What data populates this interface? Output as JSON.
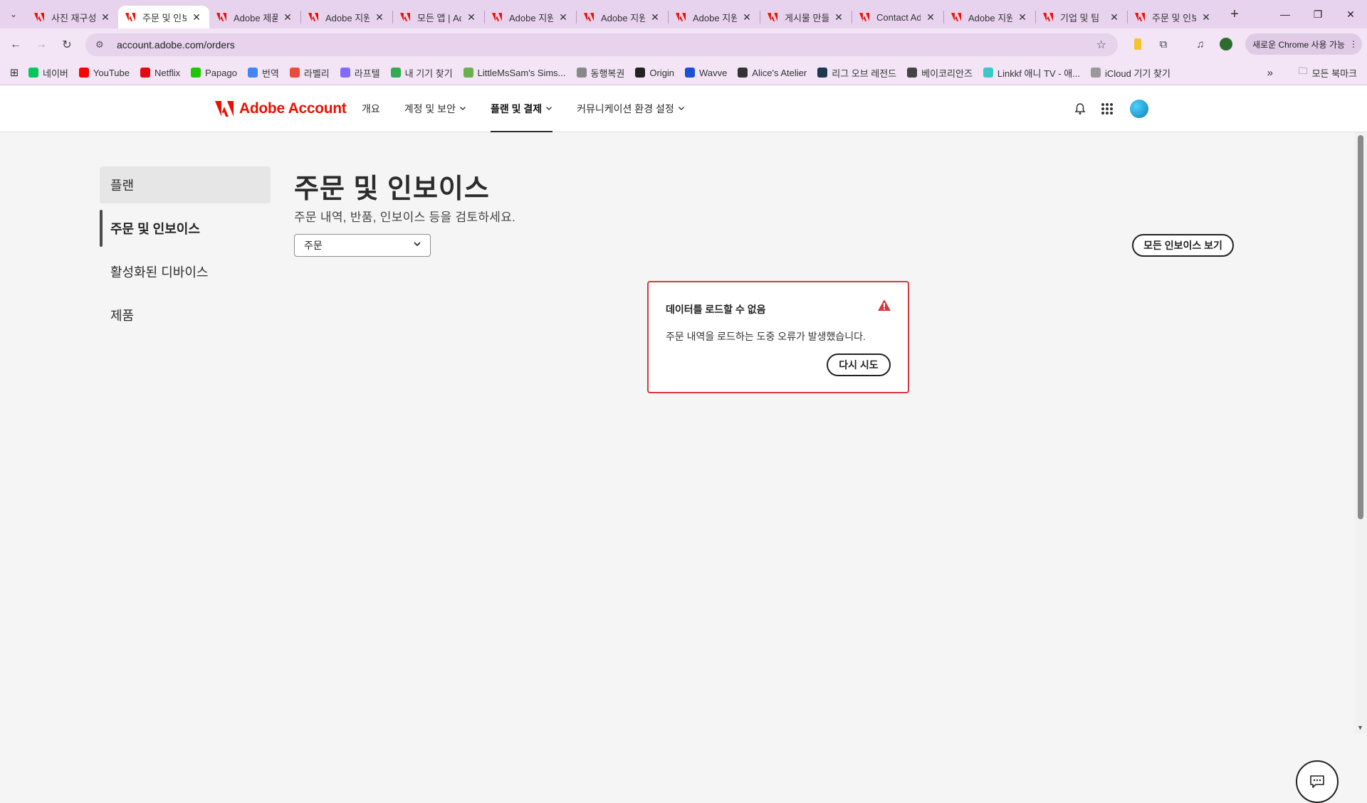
{
  "browser": {
    "tabs": [
      {
        "title": "사진 재구성",
        "active": false
      },
      {
        "title": "주문 및 인보이스",
        "active": true
      },
      {
        "title": "Adobe 제품",
        "active": false
      },
      {
        "title": "Adobe 지원",
        "active": false
      },
      {
        "title": "모든 앱 | Adobe",
        "active": false
      },
      {
        "title": "Adobe 지원",
        "active": false
      },
      {
        "title": "Adobe 지원",
        "active": false
      },
      {
        "title": "Adobe 지원",
        "active": false
      },
      {
        "title": "게시물 만들기",
        "active": false
      },
      {
        "title": "Contact Adobe",
        "active": false
      },
      {
        "title": "Adobe 지원",
        "active": false
      },
      {
        "title": "기업 및 팀",
        "active": false
      },
      {
        "title": "주문 및 인보이스",
        "active": false
      }
    ],
    "url": "account.adobe.com/orders",
    "update_label": "새로운 Chrome 사용 가능",
    "bookmarks": [
      {
        "label": "네이버",
        "color": "#03c75a"
      },
      {
        "label": "YouTube",
        "color": "#ff0000"
      },
      {
        "label": "Netflix",
        "color": "#e50914"
      },
      {
        "label": "Papago",
        "color": "#1ec800"
      },
      {
        "label": "번역",
        "color": "#4285f4"
      },
      {
        "label": "라벨리",
        "color": "#e84c3d"
      },
      {
        "label": "라프텔",
        "color": "#816bff"
      },
      {
        "label": "내 기기 찾기",
        "color": "#34a853"
      },
      {
        "label": "LittleMsSam's Sims...",
        "color": "#6ab04c"
      },
      {
        "label": "동행복권",
        "color": "#888888"
      },
      {
        "label": "Origin",
        "color": "#222222"
      },
      {
        "label": "Wavve",
        "color": "#1a4fd6"
      },
      {
        "label": "Alice's Atelier",
        "color": "#333333"
      },
      {
        "label": "리그 오브 레전드",
        "color": "#1b3a4b"
      },
      {
        "label": "베이코리안즈",
        "color": "#444444"
      },
      {
        "label": "Linkkf 애니 TV - 애...",
        "color": "#3cc7c7"
      },
      {
        "label": "iCloud 기기 찾기",
        "color": "#999999"
      }
    ],
    "all_bookmarks": "모든 북마크"
  },
  "header": {
    "logo_text": "Adobe Account",
    "nav": [
      {
        "label": "개요",
        "dropdown": false,
        "active": false
      },
      {
        "label": "계정 및 보안",
        "dropdown": true,
        "active": false
      },
      {
        "label": "플랜 및 결제",
        "dropdown": true,
        "active": true
      },
      {
        "label": "커뮤니케이션 환경 설정",
        "dropdown": true,
        "active": false
      }
    ]
  },
  "sidebar": {
    "items": [
      {
        "label": "플랜",
        "state": "hover"
      },
      {
        "label": "주문 및 인보이스",
        "state": "active"
      },
      {
        "label": "활성화된 디바이스",
        "state": ""
      },
      {
        "label": "제품",
        "state": ""
      }
    ]
  },
  "main": {
    "title": "주문 및 인보이스",
    "subtitle": "주문 내역, 반품, 인보이스 등을 검토하세요.",
    "filter_value": "주문",
    "view_all_invoices": "모든 인보이스 보기",
    "error": {
      "title": "데이터를 로드할 수 없음",
      "message": "주문 내역을 로드하는 도중 오류가 발생했습니다.",
      "retry_label": "다시 시도"
    }
  },
  "colors": {
    "adobe_red": "#eb1000",
    "error_red": "#d7373f",
    "browser_frame": "#e8d3ef"
  }
}
